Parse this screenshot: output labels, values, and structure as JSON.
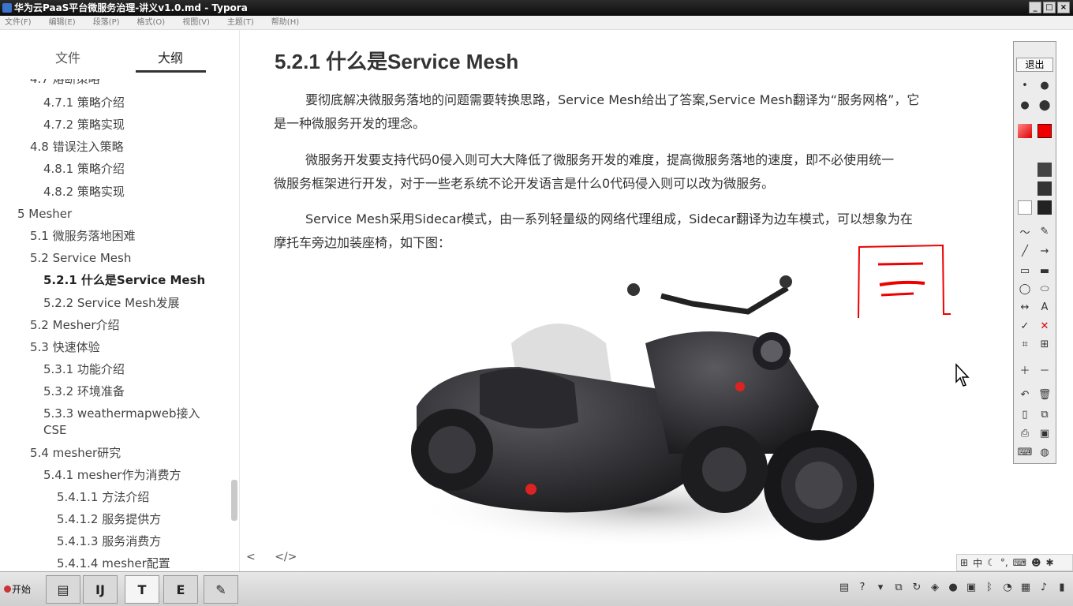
{
  "window": {
    "title": "华为云PaaS平台微服务治理-讲义v1.0.md - Typora"
  },
  "menu": [
    "文件(F)",
    "编辑(E)",
    "段落(P)",
    "格式(O)",
    "视图(V)",
    "主题(T)",
    "帮助(H)"
  ],
  "sidebar": {
    "tabs": [
      {
        "label": "文件"
      },
      {
        "label": "大纲",
        "active": true
      }
    ],
    "outline": [
      {
        "label": "4.7 熔断策略",
        "level": 2
      },
      {
        "label": "4.7.1 策略介绍",
        "level": 3
      },
      {
        "label": "4.7.2 策略实现",
        "level": 3
      },
      {
        "label": "4.8 错误注入策略",
        "level": 2
      },
      {
        "label": "4.8.1 策略介绍",
        "level": 3
      },
      {
        "label": "4.8.2 策略实现",
        "level": 3
      },
      {
        "label": "5 Mesher",
        "level": 1
      },
      {
        "label": "5.1 微服务落地困难",
        "level": 2
      },
      {
        "label": "5.2 Service Mesh",
        "level": 2
      },
      {
        "label": "5.2.1 什么是Service Mesh",
        "level": 3,
        "active": true
      },
      {
        "label": "5.2.2 Service Mesh发展",
        "level": 3
      },
      {
        "label": "5.2 Mesher介绍",
        "level": 2
      },
      {
        "label": "5.3 快速体验",
        "level": 2
      },
      {
        "label": "5.3.1 功能介绍",
        "level": 3
      },
      {
        "label": "5.3.2 环境准备",
        "level": 3
      },
      {
        "label": "5.3.3 weathermapweb接入",
        "label2": "CSE",
        "level": 3
      },
      {
        "label": "5.4 mesher研究",
        "level": 2
      },
      {
        "label": "5.4.1 mesher作为消费方",
        "level": 3
      },
      {
        "label": "5.4.1.1 方法介绍",
        "level": 4
      },
      {
        "label": "5.4.1.2 服务提供方",
        "level": 4
      },
      {
        "label": "5.4.1.3 服务消费方",
        "level": 4
      },
      {
        "label": "5.4.1.4 mesher配置",
        "level": 4
      }
    ]
  },
  "content": {
    "heading": "5.2.1 什么是Service Mesh",
    "paragraphs": [
      {
        "line1": "要彻底解决微服务落地的问题需要转换思路，Service Mesh给出了答案,Service Mesh翻译为“服务网格”，它",
        "line2": "是一种微服务开发的理念。"
      },
      {
        "line1": "微服务开发要支持代码0侵入则可大大降低了微服务开发的难度，提高微服务落地的速度，即不必使用统一",
        "line2": "微服务框架进行开发，对于一些老系统不论开发语言是什么0代码侵入则可以改为微服务。"
      },
      {
        "line1": "Service Mesh采用Sidecar模式，由一系列轻量级的网络代理组成，Sidecar翻译为边车模式，可以想象为在",
        "line2": "摩托车旁边加装座椅，如下图："
      }
    ],
    "bottom_left": "<",
    "bottom_code": "</>"
  },
  "annotation_toolbar": {
    "exit_label": "退出"
  },
  "taskbar": {
    "start_label": "开始",
    "tasks": [
      "",
      "",
      "T",
      "E",
      ""
    ]
  },
  "tray_ime": "中"
}
